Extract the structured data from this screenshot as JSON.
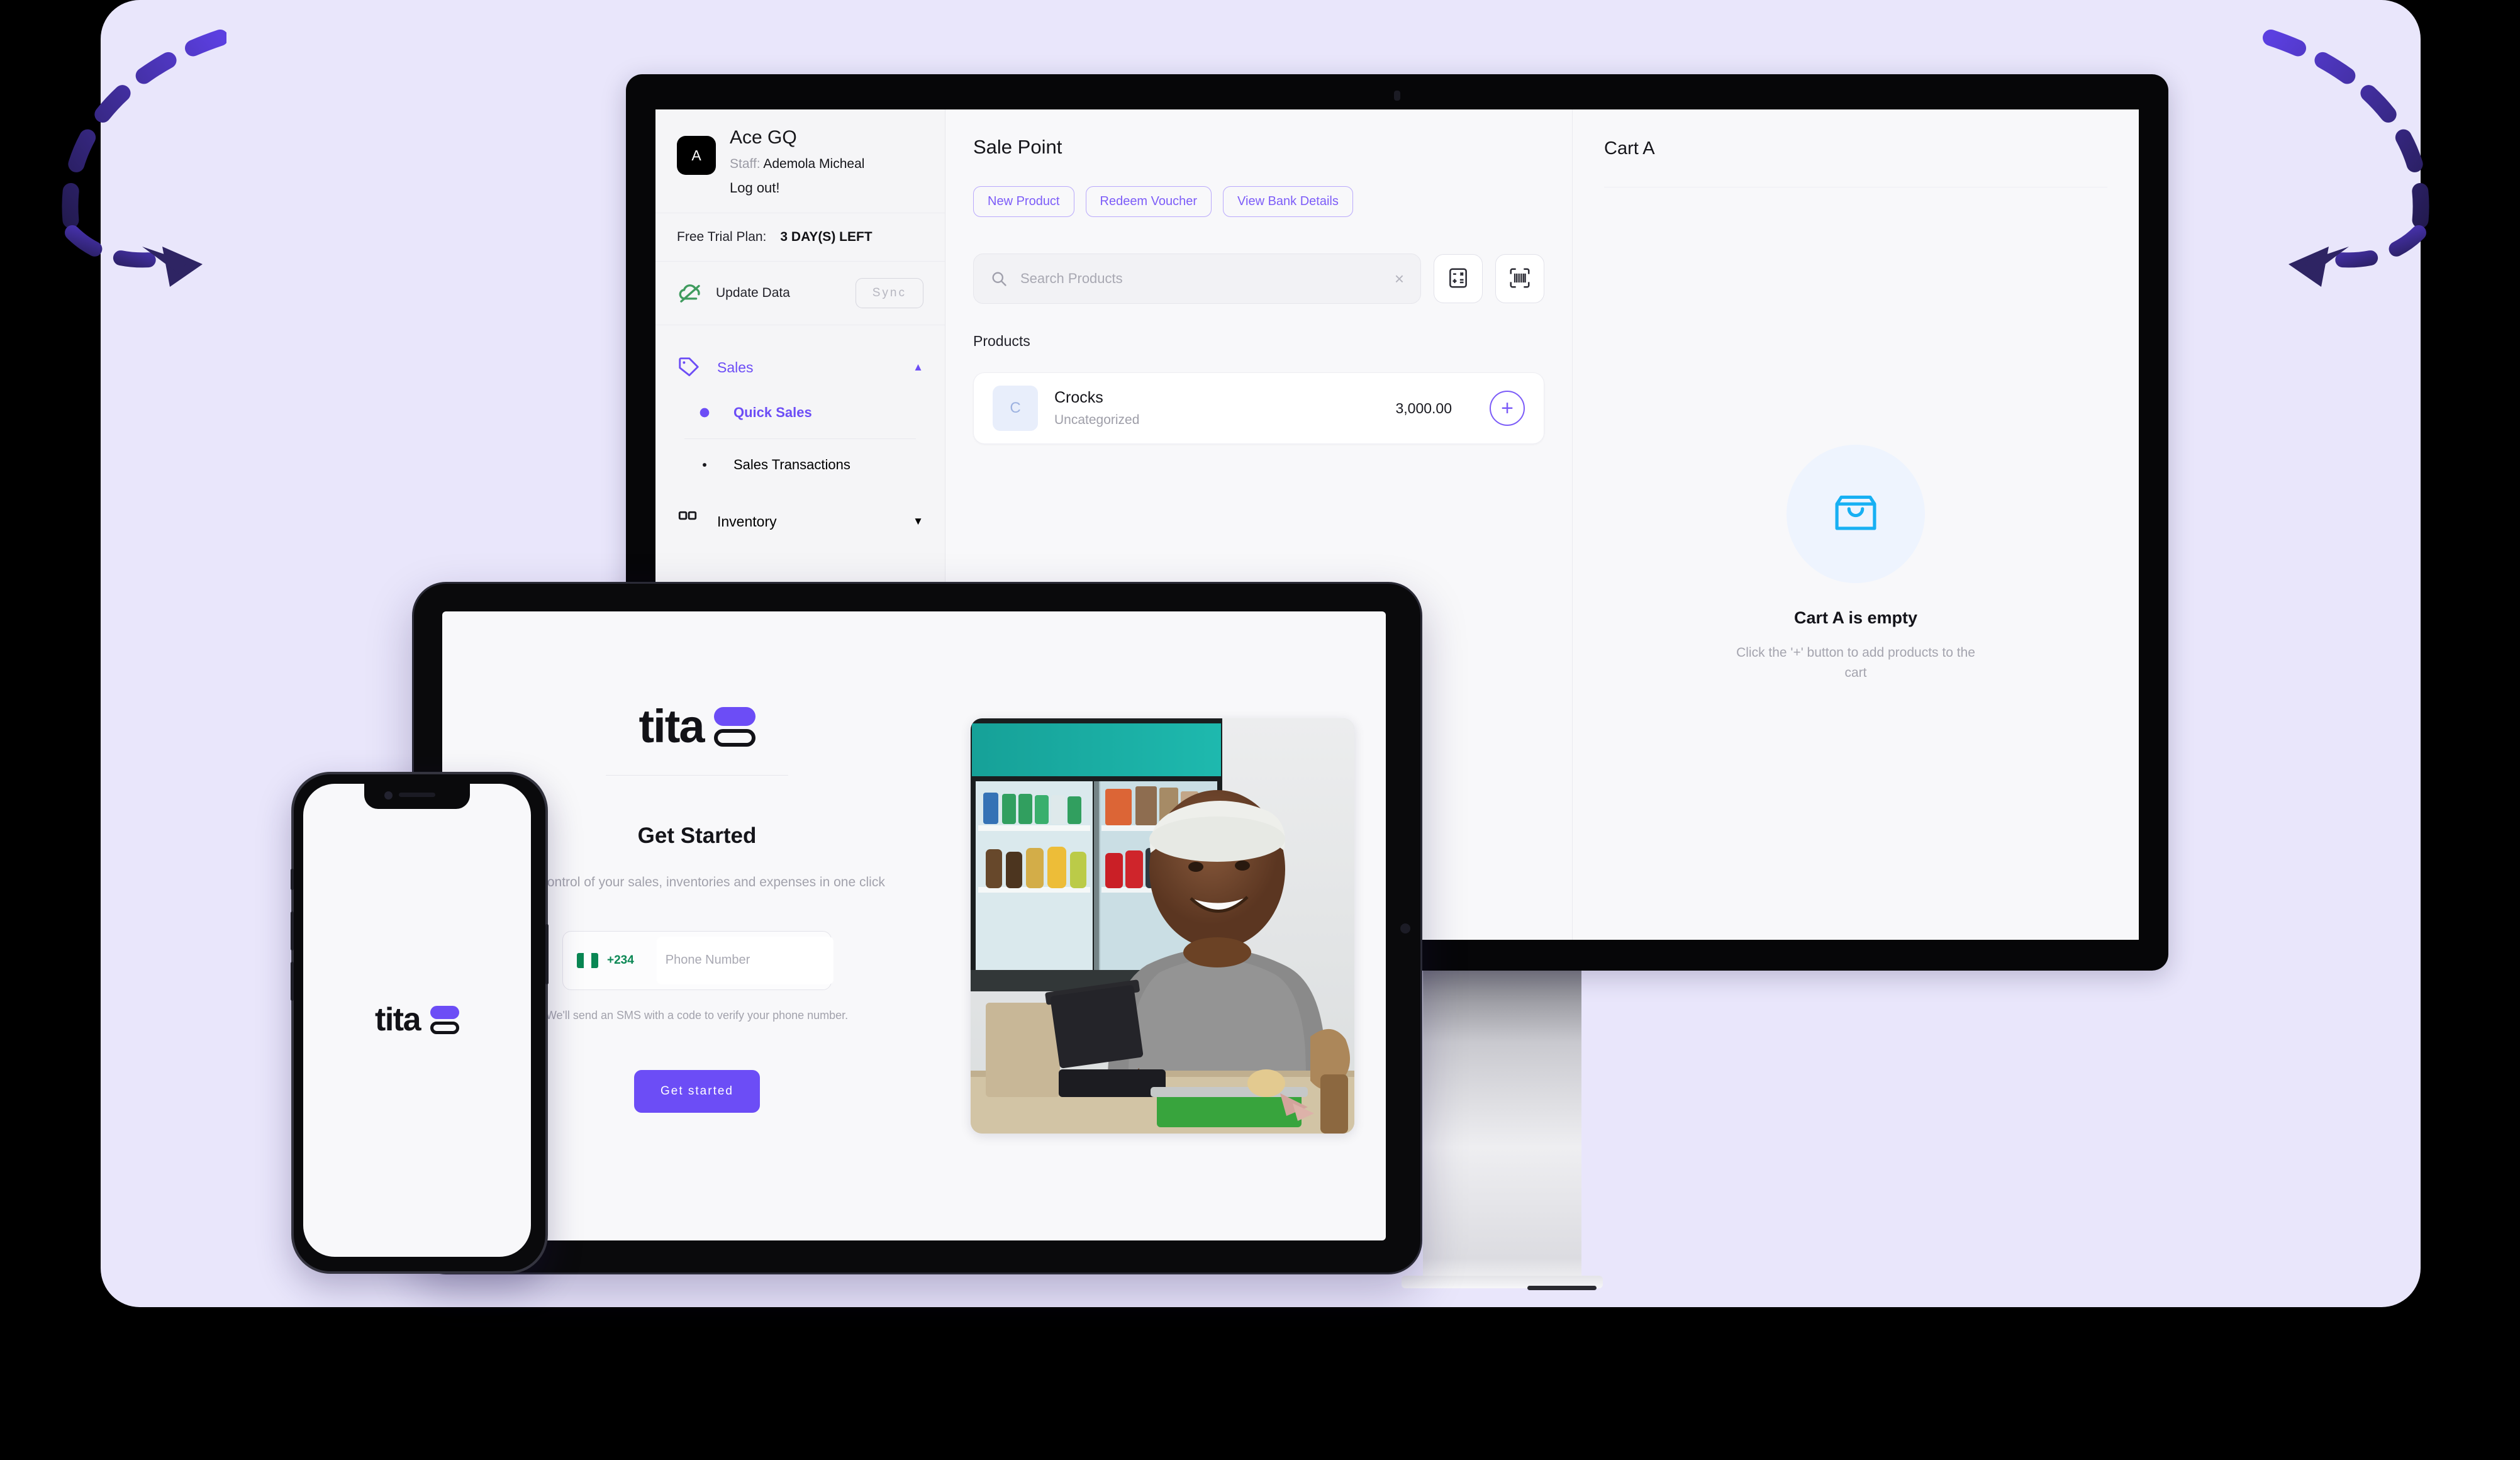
{
  "brand": {
    "name": "tita",
    "accent": "#6c4df6",
    "card_bg": "#e9e6fb"
  },
  "monitor": {
    "sidebar": {
      "account": {
        "avatar_initial": "A",
        "business_name": "Ace GQ",
        "staff_label": "Staff:",
        "staff_name": "Ademola Micheal",
        "logout_label": "Log out!"
      },
      "plan": {
        "label": "Free Trial Plan:",
        "value": "3 DAY(S) LEFT"
      },
      "sync": {
        "label": "Update Data",
        "button_label": "Sync",
        "icon": "cloud-off-icon"
      },
      "nav": [
        {
          "label": "Sales",
          "icon": "tag-icon",
          "expanded": true,
          "caret": "▲",
          "active": true,
          "children": [
            {
              "label": "Quick Sales",
              "active": true
            },
            {
              "label": "Sales Transactions",
              "active": false
            }
          ]
        },
        {
          "label": "Inventory",
          "icon": "grid-icon",
          "expanded": false,
          "caret": "▼",
          "active": false,
          "children": []
        }
      ]
    },
    "main": {
      "title": "Sale Point",
      "action_pills": [
        "New Product",
        "Redeem Voucher",
        "View Bank Details"
      ],
      "search": {
        "placeholder": "Search Products",
        "value": "",
        "clear_glyph": "×",
        "search_icon": "magnifier-icon"
      },
      "tool_buttons": [
        {
          "name": "calculator-icon",
          "title": "Calculator"
        },
        {
          "name": "barcode-scanner-icon",
          "title": "Scan barcode"
        }
      ],
      "products_label": "Products",
      "products": [
        {
          "thumb_initial": "C",
          "name": "Crocks",
          "category": "Uncategorized",
          "price": "3,000.00",
          "add_glyph": "+"
        }
      ]
    },
    "cart": {
      "title": "Cart A",
      "empty_icon": "shopping-bag-icon",
      "empty_title": "Cart A is empty",
      "empty_hint": "Click the '+' button to add products to the cart"
    }
  },
  "tablet": {
    "logo_word": "tita",
    "heading": "Get Started",
    "subheading": "Take control of your sales, inventories and expenses in one click",
    "phone_field": {
      "flag": "nigeria-flag-icon",
      "dial_code": "+234",
      "placeholder": "Phone Number",
      "value": ""
    },
    "helper_text": "We'll send an SMS with a code to verify your phone number.",
    "cta_label": "Get started",
    "photo_alt": "Smiling shopkeeper at a store counter with a point-of-sale terminal"
  },
  "phone": {
    "logo_word": "tita"
  }
}
